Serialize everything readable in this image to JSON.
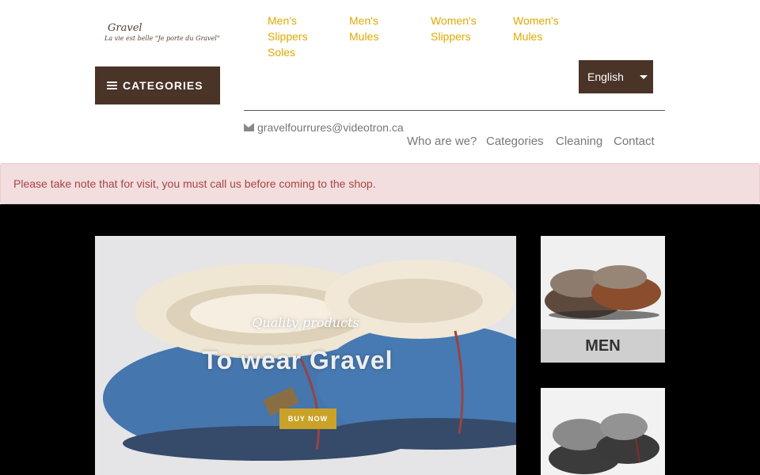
{
  "brand": {
    "logo_name": "Gravel",
    "logo_tagline": "La vie est belle \"Je porte du Gravel\""
  },
  "header": {
    "categories_label": "CATEGORIES",
    "top_links": [
      {
        "label": "Men's Slippers Soles"
      },
      {
        "label": "Men's Mules"
      },
      {
        "label": "Women's Slippers"
      },
      {
        "label": "Women's Mules"
      }
    ],
    "language": "English",
    "email": "gravelfourrures@videotron.ca",
    "subnav": [
      {
        "label": "Who are we?"
      },
      {
        "label": "Categories"
      },
      {
        "label": "Cleaning"
      },
      {
        "label": "Contact"
      }
    ]
  },
  "notice": {
    "text": "Please take note that for visit, you must call us before coming to the shop."
  },
  "hero": {
    "subtitle": "Quality products",
    "title": "To wear Gravel",
    "button_label": "BUY NOW",
    "accent_color": "#c9a227"
  },
  "tiles": [
    {
      "caption": "MEN"
    },
    {
      "caption": ""
    }
  ],
  "colors": {
    "brand_brown": "#4a3327",
    "link_gold": "#e0a800",
    "notice_text": "#a94442",
    "notice_bg": "#f2dede"
  }
}
